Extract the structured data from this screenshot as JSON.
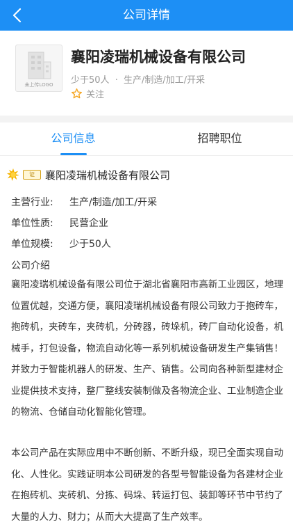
{
  "nav": {
    "title": "公司详情"
  },
  "company": {
    "name": "襄阳凌瑞机械设备有限公司",
    "logo_placeholder": "未上传LOGO",
    "size": "少于50人",
    "separator": "·",
    "industry": "生产/制造/加工/开采",
    "follow_label": "关注"
  },
  "tabs": [
    {
      "label": "公司信息",
      "active": true
    },
    {
      "label": "招聘职位",
      "active": false
    }
  ],
  "info": {
    "cert_label": "证",
    "badge_name": "襄阳凌瑞机械设备有限公司",
    "fields": [
      {
        "label": "主营行业:",
        "value": "生产/制造/加工/开采"
      },
      {
        "label": "单位性质:",
        "value": "民营企业"
      },
      {
        "label": "单位规模:",
        "value": "少于50人"
      }
    ],
    "intro_title": "公司介绍",
    "paragraphs": [
      "襄阳凌瑞机械设备有限公司位于湖北省襄阳市高新工业园区，地理位置优越，交通方便，襄阳凌瑞机械设备有限公司致力于抱砖车，抱砖机，夹砖车，夹砖机，分砖器，砖垛机，砖厂自动化设备，机械手，打包设备，物流自动化等一系列机械设备研发生产集销售！并致力于智能机器人的研发、生产、销售。公司向各种新型建材企业提供技术支持，整厂整线安装制做及各物流企业、工业制造企业的物流、仓储自动化智能化管理。",
      "本公司产品在实际应用中不断创新、不断升级，现已全面实现自动化、人性化。实践证明本公司研发的各型号智能设备为各建材企业在抱砖机、夹砖机、分拣、码垛、转运打包、装卸等环节中节约了大量的人力、财力；从而大大提高了生产效率。"
    ]
  },
  "colors": {
    "accent": "#1d8ff5",
    "star": "#f5a623"
  }
}
